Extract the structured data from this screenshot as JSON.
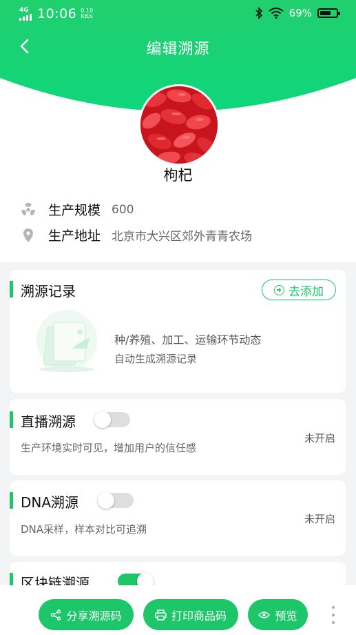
{
  "status_bar": {
    "network": "4G",
    "time": "10:06",
    "speed_value": "0.10",
    "speed_unit": "KB/s",
    "battery_percent": "69%",
    "battery_level": 0.69
  },
  "header": {
    "title": "编辑溯源",
    "back_icon": "chevron-left-icon"
  },
  "product": {
    "name": "枸杞"
  },
  "info": [
    {
      "icon": "radiation-icon",
      "label": "生产规模",
      "value": "600"
    },
    {
      "icon": "location-pin-icon",
      "label": "生产地址",
      "value": "北京市大兴区郊外青青农场"
    }
  ],
  "trace_record": {
    "title": "溯源记录",
    "add_label": "去添加",
    "line1": "种/养殖、加工、运输环节动态",
    "line2": "自动生成溯源记录"
  },
  "live_trace": {
    "title": "直播溯源",
    "desc": "生产环境实时可见，增加用户的信任感",
    "status": "未开启",
    "enabled": false
  },
  "dna_trace": {
    "title": "DNA溯源",
    "desc": "DNA采样，样本对比可追溯",
    "status": "未开启",
    "enabled": false
  },
  "blockchain_trace": {
    "title": "区块链溯源",
    "enabled": true
  },
  "bottom": {
    "share_label": "分享溯源码",
    "print_label": "打印商品码",
    "preview_label": "预览",
    "more_icon": "more-vertical-icon"
  },
  "colors": {
    "accent": "#1DC668",
    "header_top": "#1FCF6B",
    "background": "#F3F4F5"
  }
}
